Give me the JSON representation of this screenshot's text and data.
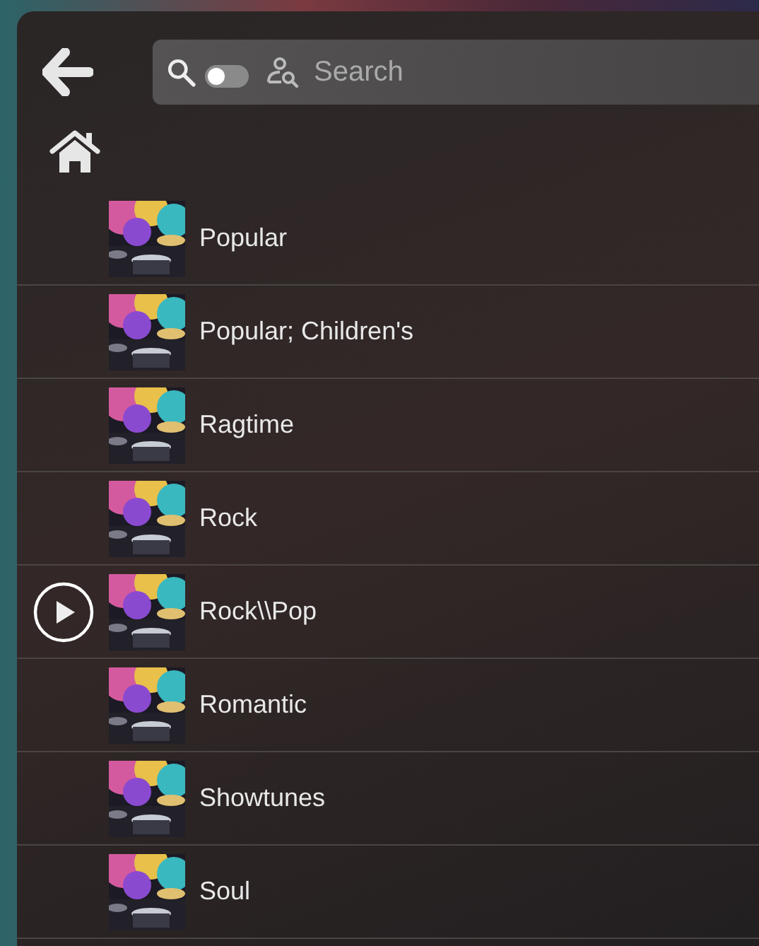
{
  "search": {
    "placeholder": "Search",
    "toggle_on": false
  },
  "items": [
    {
      "title": "Popular",
      "playing": false
    },
    {
      "title": "Popular; Children's",
      "playing": false
    },
    {
      "title": "Ragtime",
      "playing": false
    },
    {
      "title": "Rock",
      "playing": false
    },
    {
      "title": "Rock\\\\Pop",
      "playing": true
    },
    {
      "title": "Romantic",
      "playing": false
    },
    {
      "title": "Showtunes",
      "playing": false
    },
    {
      "title": "Soul",
      "playing": false
    }
  ]
}
